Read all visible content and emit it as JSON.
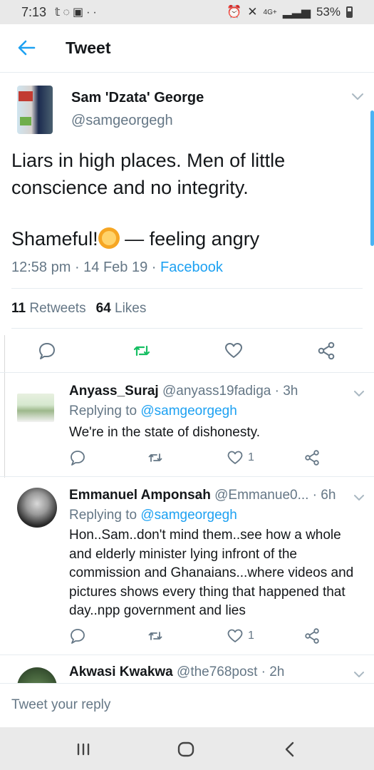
{
  "status_bar": {
    "time": "7:13",
    "left_icons": [
      "twitter-icon",
      "whatsapp-icon",
      "youtube-icon",
      "more-dots-icon"
    ],
    "right_icons": [
      "alarm-icon",
      "mute-icon",
      "network-4g-icon",
      "signal-icon"
    ],
    "battery": "53%"
  },
  "header": {
    "title": "Tweet"
  },
  "tweet": {
    "author_name": "Sam 'Dzata' George",
    "author_handle": "@samgeorgegh",
    "text_line1": "Liars in high places. Men of little conscience and no integrity.",
    "text_line2_prefix": "Shameful!",
    "text_line2_suffix": " — feeling angry",
    "timestamp": "12:58 pm · 14 Feb 19 · ",
    "source": "Facebook",
    "retweets_count": "11",
    "retweets_label": "Retweets",
    "likes_count": "64",
    "likes_label": "Likes"
  },
  "replies": [
    {
      "name": "Anyass_Suraj",
      "handle_time": " @anyass19fadiga · 3h",
      "replying_prefix": "Replying to ",
      "replying_to": "@samgeorgegh",
      "text": "We're in the state of dishonesty.",
      "likes": "1"
    },
    {
      "name": "Emmanuel Amponsah",
      "handle_time": " @Emmanue0... · 6h",
      "replying_prefix": "Replying to ",
      "replying_to": "@samgeorgegh",
      "text": "Hon..Sam..don't mind them..see how a whole and elderly minister lying  infront of the commission and Ghanaians...where videos and pictures shows every thing that happened that day..npp government and lies",
      "likes": "1"
    },
    {
      "name": "Akwasi Kwakwa",
      "handle_time": " @the768post · 2h"
    }
  ],
  "reply_bar": {
    "placeholder": "Tweet your reply"
  },
  "colors": {
    "accent": "#1da1f2",
    "retweet_active": "#17bf63",
    "muted": "#657786"
  }
}
